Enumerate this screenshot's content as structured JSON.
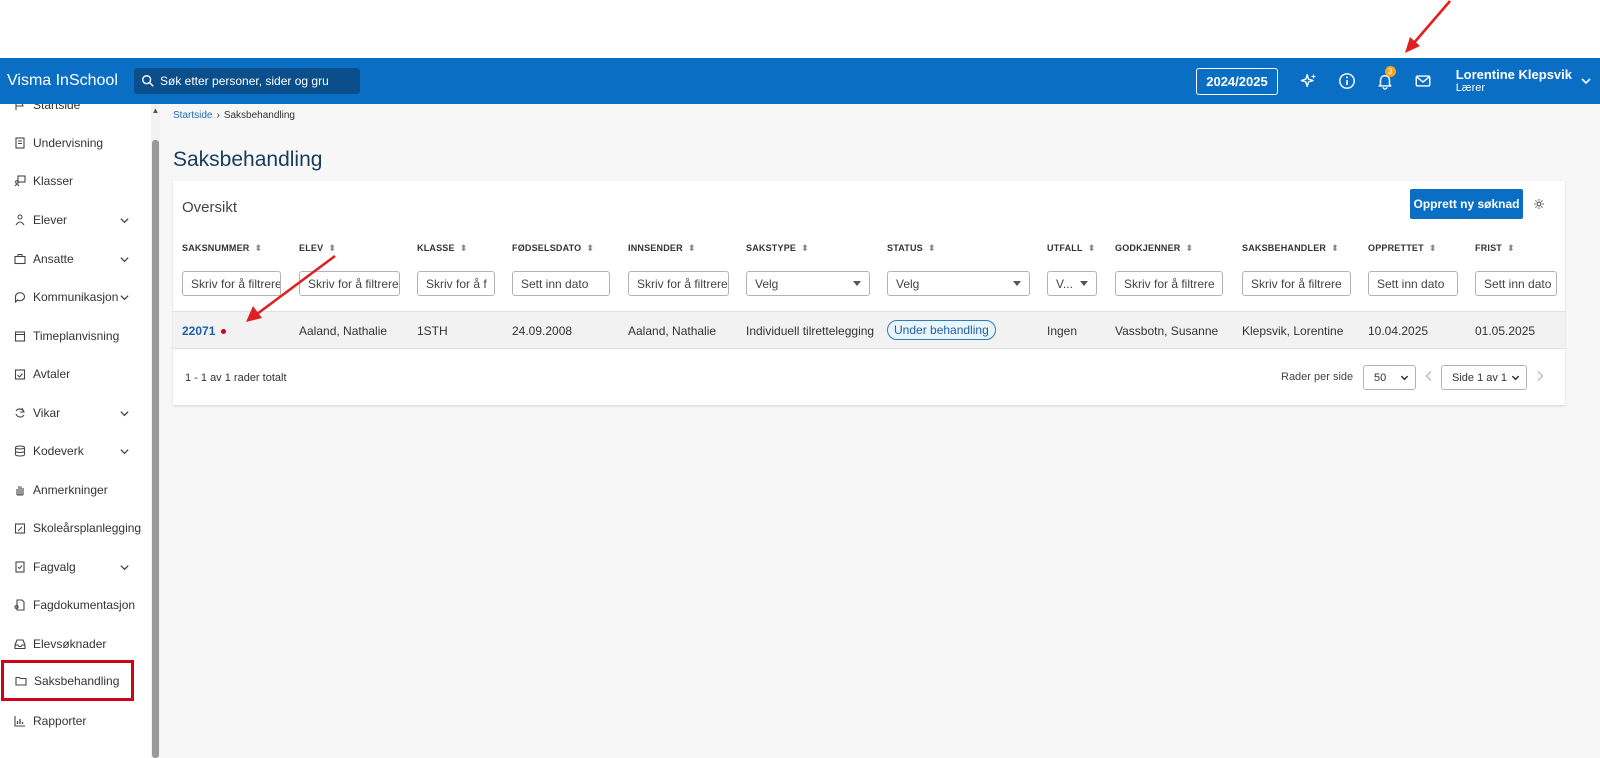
{
  "app": {
    "brand": "Visma InSchool",
    "search_placeholder": "Søk etter personer, sider og gru",
    "school_year": "2024/2025",
    "notification_count": "3",
    "user_name": "Lorentine Klepsvik",
    "user_role": "Lærer"
  },
  "sidebar": {
    "items": [
      {
        "label": "Startside",
        "icon": "flag-icon",
        "chevron": false
      },
      {
        "label": "Undervisning",
        "icon": "book-icon",
        "chevron": false
      },
      {
        "label": "Klasser",
        "icon": "classroom-icon",
        "chevron": false
      },
      {
        "label": "Elever",
        "icon": "students-icon",
        "chevron": true
      },
      {
        "label": "Ansatte",
        "icon": "briefcase-icon",
        "chevron": true
      },
      {
        "label": "Kommunikasjon",
        "icon": "chat-icon",
        "chevron": true
      },
      {
        "label": "Timeplanvisning",
        "icon": "calendar-icon",
        "chevron": false
      },
      {
        "label": "Avtaler",
        "icon": "calendar-check-icon",
        "chevron": false
      },
      {
        "label": "Vikar",
        "icon": "refresh-icon",
        "chevron": true
      },
      {
        "label": "Kodeverk",
        "icon": "database-icon",
        "chevron": true
      },
      {
        "label": "Anmerkninger",
        "icon": "hand-icon",
        "chevron": false
      },
      {
        "label": "Skoleårsplanlegging",
        "icon": "calendar-edit-icon",
        "chevron": false
      },
      {
        "label": "Fagvalg",
        "icon": "checklist-icon",
        "chevron": true
      },
      {
        "label": "Fagdokumentasjon",
        "icon": "document-icon",
        "chevron": false
      },
      {
        "label": "Elevsøknader",
        "icon": "inbox-icon",
        "chevron": false
      },
      {
        "label": "Saksbehandling",
        "icon": "folder-icon",
        "chevron": false,
        "active": true
      },
      {
        "label": "Rapporter",
        "icon": "chart-icon",
        "chevron": false
      }
    ]
  },
  "breadcrumb": {
    "home": "Startside",
    "current": "Saksbehandling"
  },
  "page_title": "Saksbehandling",
  "card": {
    "title": "Oversikt",
    "new_button": "Opprett ny søknad"
  },
  "table": {
    "columns": [
      "SAKSNUMMER",
      "ELEV",
      "KLASSE",
      "FØDSELSDATO",
      "INNSENDER",
      "SAKSTYPE",
      "STATUS",
      "UTFALL",
      "GODKJENNER",
      "SAKSBEHANDLER",
      "OPPRETTET",
      "FRIST"
    ],
    "filters": [
      "Skriv for å filtrere",
      "Skriv for å filtrere",
      "Skriv for å f",
      "Sett inn dato",
      "Skriv for å filtrere",
      "Velg",
      "Velg",
      "V...",
      "Skriv for å filtrere",
      "Skriv for å filtrere",
      "Sett inn dato",
      "Sett inn dato"
    ],
    "rows": [
      [
        "22071",
        "Aaland, Nathalie",
        "1STH",
        "24.09.2008",
        "Aaland, Nathalie",
        "Individuell tilrettelegging",
        "Under behandling",
        "Ingen",
        "Vassbotn, Susanne",
        "Klepsvik, Lorentine",
        "10.04.2025",
        "01.05.2025"
      ]
    ]
  },
  "footer": {
    "summary": "1 - 1 av 1 rader totalt",
    "rows_per_page_label": "Rader per side",
    "rows_per_page": "50",
    "page_label": "Side 1 av 1"
  },
  "colors": {
    "brand": "#0a6fc4",
    "annotation": "#e02020",
    "active_border": "#d0021b"
  }
}
